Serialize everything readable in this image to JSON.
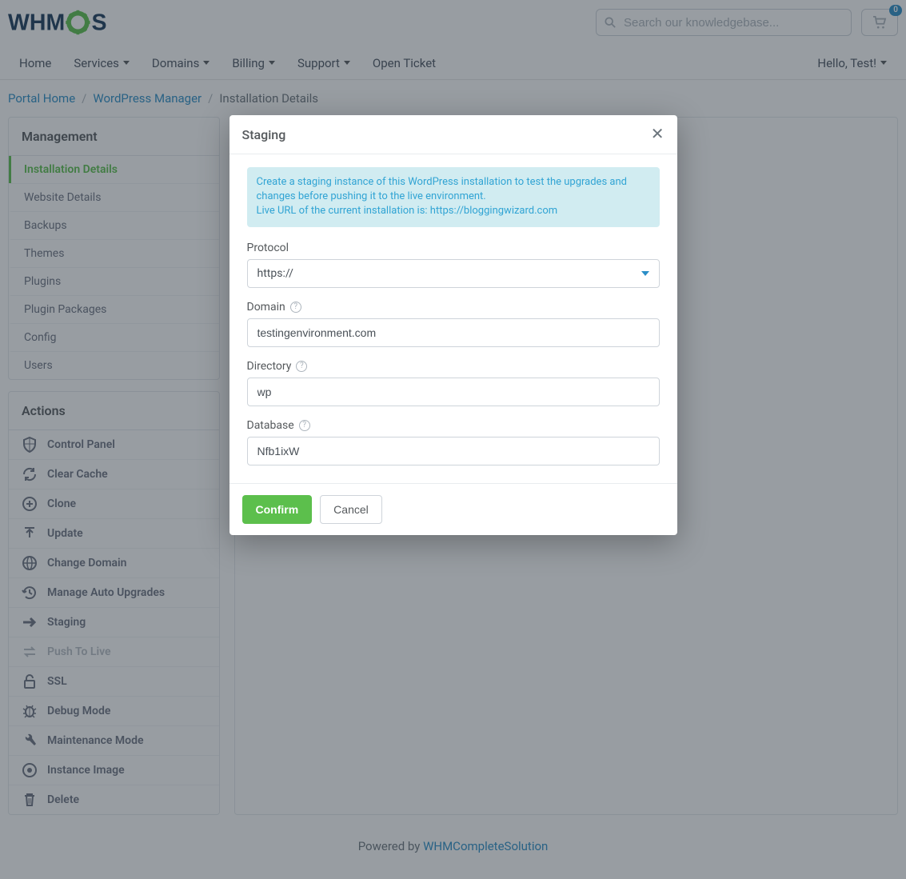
{
  "logo_text": "WHMCS",
  "search": {
    "placeholder": "Search our knowledgebase..."
  },
  "cart": {
    "count": "0"
  },
  "nav": {
    "home": "Home",
    "services": "Services",
    "domains": "Domains",
    "billing": "Billing",
    "support": "Support",
    "open_ticket": "Open Ticket",
    "greeting": "Hello, Test!"
  },
  "breadcrumb": {
    "portal_home": "Portal Home",
    "wp_manager": "WordPress Manager",
    "current": "Installation Details"
  },
  "sidebar": {
    "management": {
      "title": "Management",
      "items": [
        {
          "label": "Installation Details",
          "active": true
        },
        {
          "label": "Website Details"
        },
        {
          "label": "Backups"
        },
        {
          "label": "Themes"
        },
        {
          "label": "Plugins"
        },
        {
          "label": "Plugin Packages"
        },
        {
          "label": "Config"
        },
        {
          "label": "Users"
        }
      ]
    },
    "actions": {
      "title": "Actions",
      "items": [
        {
          "label": "Control Panel",
          "icon": "shield",
          "name": "action-control-panel"
        },
        {
          "label": "Clear Cache",
          "icon": "refresh",
          "name": "action-clear-cache"
        },
        {
          "label": "Clone",
          "icon": "plus-circle",
          "name": "action-clone"
        },
        {
          "label": "Update",
          "icon": "upload",
          "name": "action-update"
        },
        {
          "label": "Change Domain",
          "icon": "globe",
          "name": "action-change-domain"
        },
        {
          "label": "Manage Auto Upgrades",
          "icon": "history",
          "name": "action-auto-upgrades"
        },
        {
          "label": "Staging",
          "icon": "arrow-right",
          "name": "action-staging"
        },
        {
          "label": "Push To Live",
          "icon": "swap",
          "name": "action-push-to-live",
          "disabled": true
        },
        {
          "label": "SSL",
          "icon": "lock",
          "name": "action-ssl"
        },
        {
          "label": "Debug Mode",
          "icon": "bug",
          "name": "action-debug-mode"
        },
        {
          "label": "Maintenance Mode",
          "icon": "wrench",
          "name": "action-maintenance-mode"
        },
        {
          "label": "Instance Image",
          "icon": "image",
          "name": "action-instance-image"
        },
        {
          "label": "Delete",
          "icon": "trash",
          "name": "action-delete"
        }
      ]
    }
  },
  "modal": {
    "title": "Staging",
    "info_line1": "Create a staging instance of this WordPress installation to test the upgrades and changes before pushing it to the live environment.",
    "info_line2": "Live URL of the current installation is: https://bloggingwizard.com",
    "protocol_label": "Protocol",
    "protocol_value": "https://",
    "domain_label": "Domain",
    "domain_value": "testingenvironment.com",
    "directory_label": "Directory",
    "directory_value": "wp",
    "database_label": "Database",
    "database_value": "Nfb1ixW",
    "confirm": "Confirm",
    "cancel": "Cancel"
  },
  "footer": {
    "powered_by": "Powered by ",
    "brand": "WHMCompleteSolution"
  }
}
